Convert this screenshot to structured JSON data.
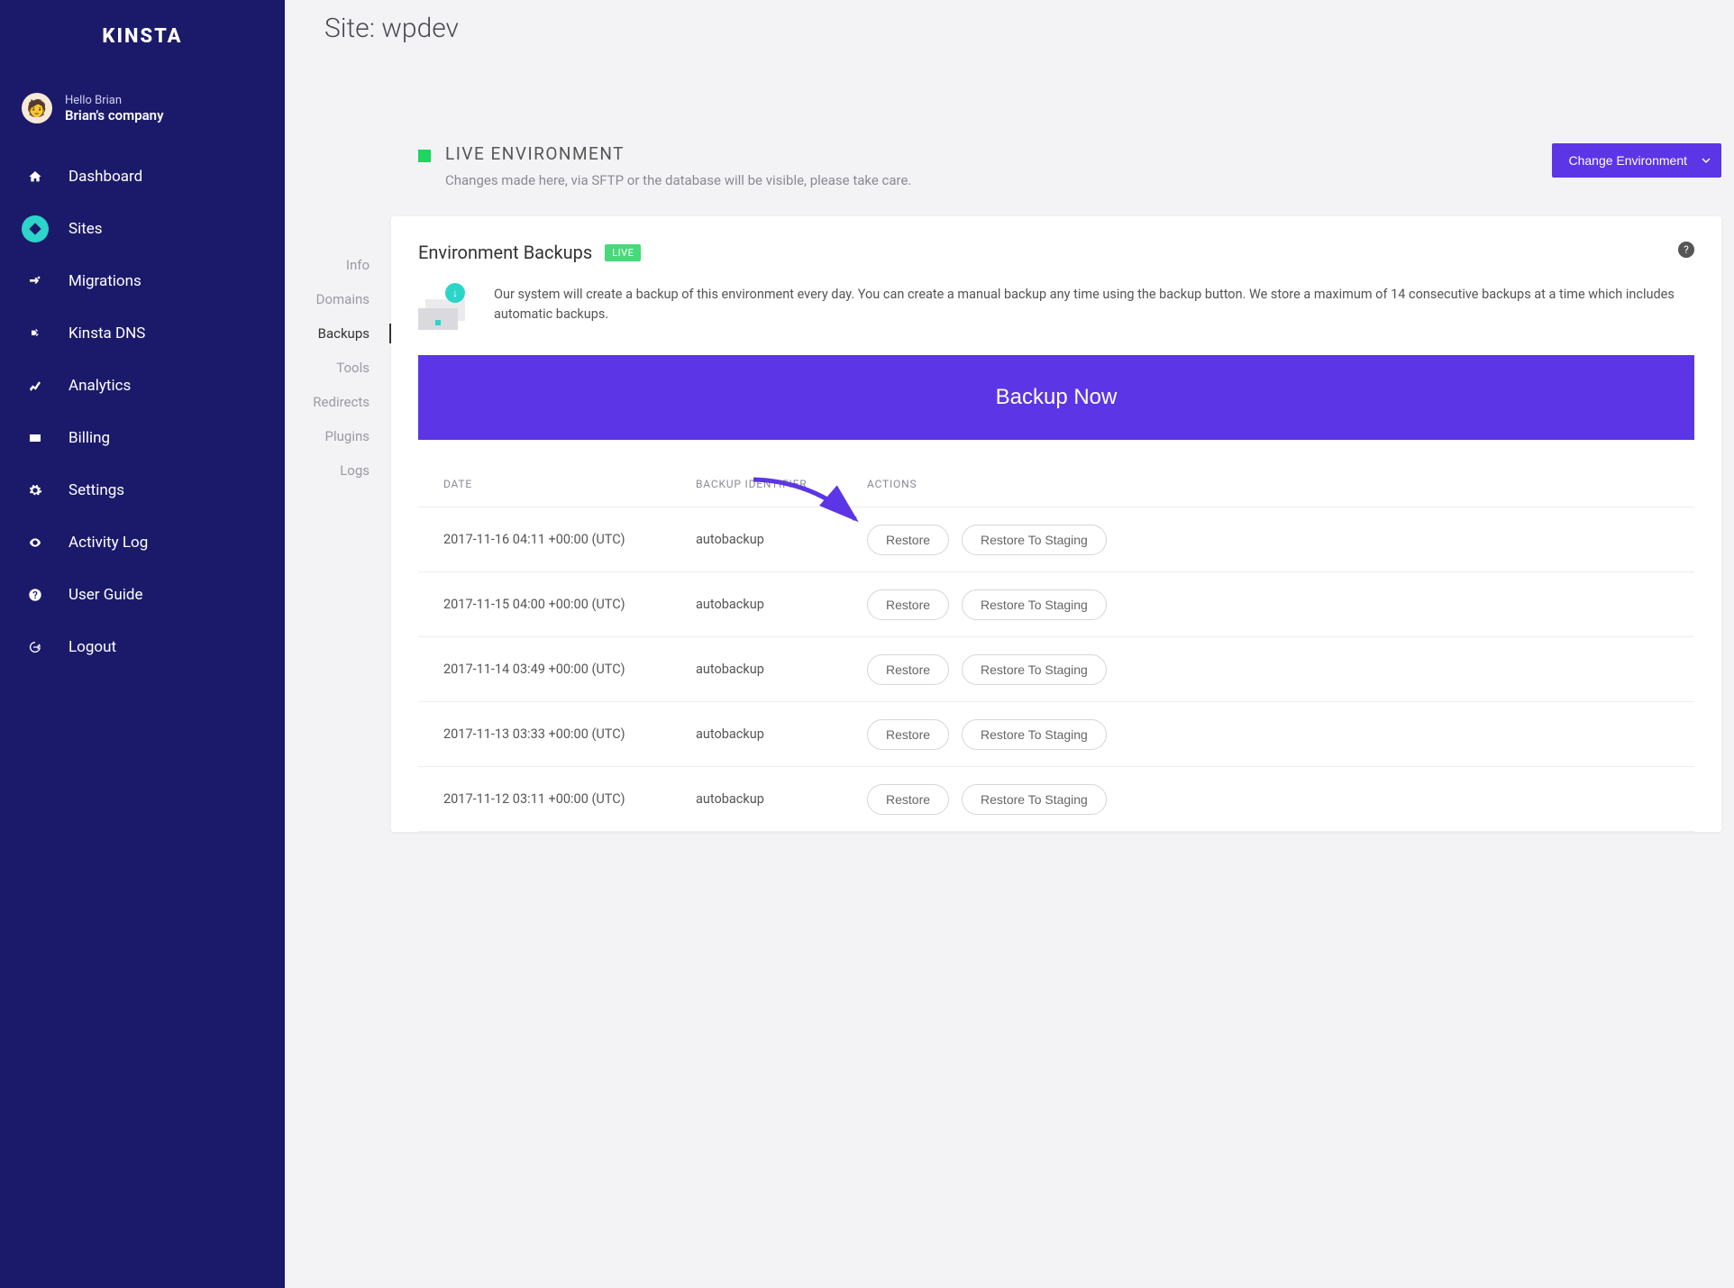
{
  "brand": "KINSTA",
  "user": {
    "greeting": "Hello Brian",
    "company": "Brian's company"
  },
  "nav": {
    "items": [
      {
        "label": "Dashboard",
        "icon": "home"
      },
      {
        "label": "Sites",
        "icon": "sites",
        "active": true
      },
      {
        "label": "Migrations",
        "icon": "migrations"
      },
      {
        "label": "Kinsta DNS",
        "icon": "dns"
      },
      {
        "label": "Analytics",
        "icon": "analytics"
      },
      {
        "label": "Billing",
        "icon": "billing"
      },
      {
        "label": "Settings",
        "icon": "settings"
      },
      {
        "label": "Activity Log",
        "icon": "activity"
      },
      {
        "label": "User Guide",
        "icon": "guide"
      },
      {
        "label": "Logout",
        "icon": "logout"
      }
    ]
  },
  "page_title": "Site: wpdev",
  "subnav": {
    "items": [
      {
        "label": "Info"
      },
      {
        "label": "Domains"
      },
      {
        "label": "Backups",
        "active": true
      },
      {
        "label": "Tools"
      },
      {
        "label": "Redirects"
      },
      {
        "label": "Plugins"
      },
      {
        "label": "Logs"
      }
    ]
  },
  "env": {
    "name": "LIVE ENVIRONMENT",
    "desc": "Changes made here, via SFTP or the database will be visible, please take care.",
    "change_label": "Change Environment",
    "status_color": "#1ed65f"
  },
  "panel": {
    "title": "Environment Backups",
    "badge": "LIVE",
    "help": "?",
    "intro": "Our system will create a backup of this environment every day. You can create a manual backup any time using the backup button. We store a maximum of 14 consecutive backups at a time which includes automatic backups.",
    "backup_now": "Backup Now",
    "columns": {
      "date": "DATE",
      "identifier": "BACKUP IDENTIFIER",
      "actions": "ACTIONS"
    },
    "action_labels": {
      "restore": "Restore",
      "restore_staging": "Restore To Staging"
    },
    "rows": [
      {
        "date": "2017-11-16 04:11 +00:00 (UTC)",
        "identifier": "autobackup"
      },
      {
        "date": "2017-11-15 04:00 +00:00 (UTC)",
        "identifier": "autobackup"
      },
      {
        "date": "2017-11-14 03:49 +00:00 (UTC)",
        "identifier": "autobackup"
      },
      {
        "date": "2017-11-13 03:33 +00:00 (UTC)",
        "identifier": "autobackup"
      },
      {
        "date": "2017-11-12 03:11 +00:00 (UTC)",
        "identifier": "autobackup"
      }
    ]
  },
  "colors": {
    "accent": "#5c35e6",
    "sidebar": "#1b1a6a",
    "teal": "#2cd4c9"
  }
}
